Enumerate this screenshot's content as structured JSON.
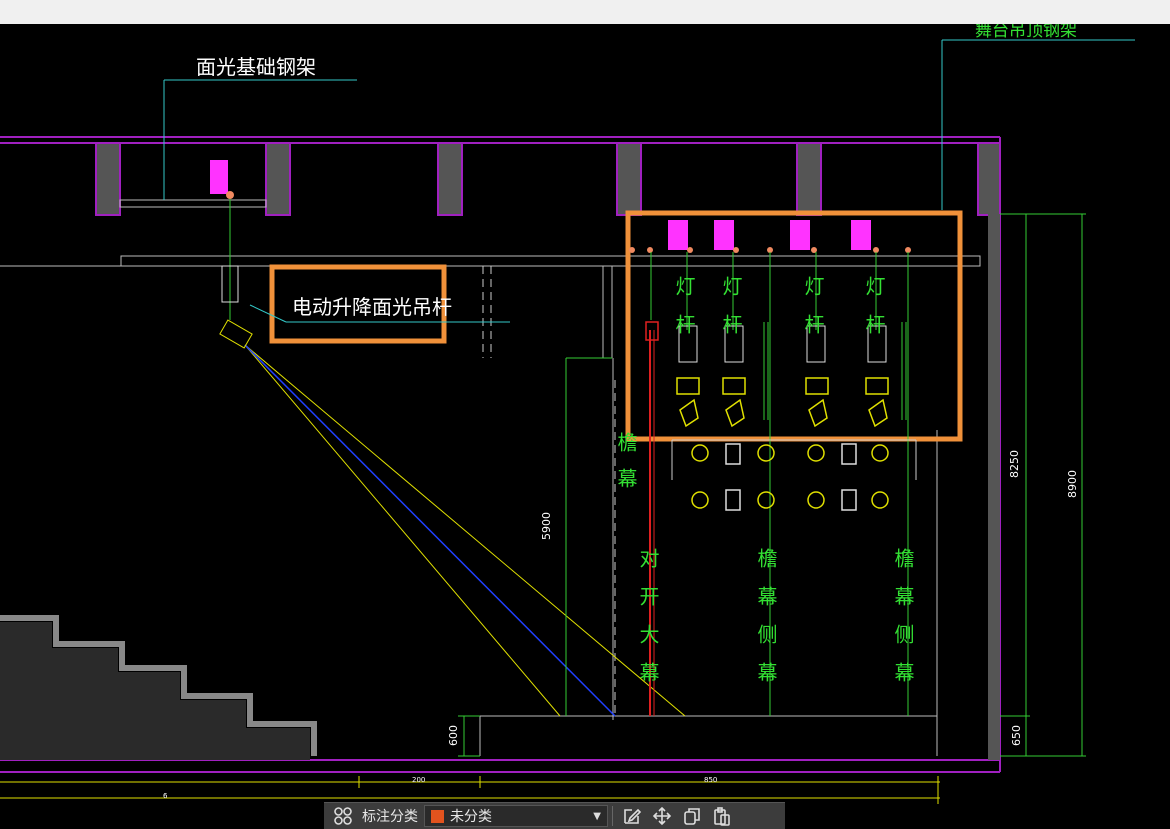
{
  "drawing": {
    "labels": {
      "face_light_truss": "面光基础钢架",
      "stage_truss": "舞台吊顶钢架",
      "motor_batten": "电动升降面光吊杆",
      "light_bar_1": "灯杆",
      "light_bar_2": "灯杆",
      "light_bar_3": "灯杆",
      "light_bar_4": "灯杆",
      "eave_curtain": "檐幕",
      "main_curtain": "对开大幕",
      "side_curtain_1": "檐幕侧幕",
      "side_curtain_2": "檐幕侧幕"
    },
    "dimensions": {
      "d5900": "5900",
      "d8250": "8250",
      "d8900": "8900",
      "d600": "600",
      "d650": "650",
      "d200": "200",
      "d850": "850",
      "d6xxx": "6"
    },
    "colors": {
      "frame": "#a020c0",
      "callout": "#f0913a",
      "text_green": "#33e033",
      "dim_green": "#33cc33",
      "magenta": "#ff33ff",
      "yellow": "#f0f000",
      "red": "#e02020"
    }
  },
  "toolbar": {
    "annotation_label": "标注分类",
    "category_value": "未分类",
    "icons": [
      "grid-icon",
      "edit-icon",
      "move-icon",
      "copy-icon",
      "paste-icon"
    ]
  }
}
